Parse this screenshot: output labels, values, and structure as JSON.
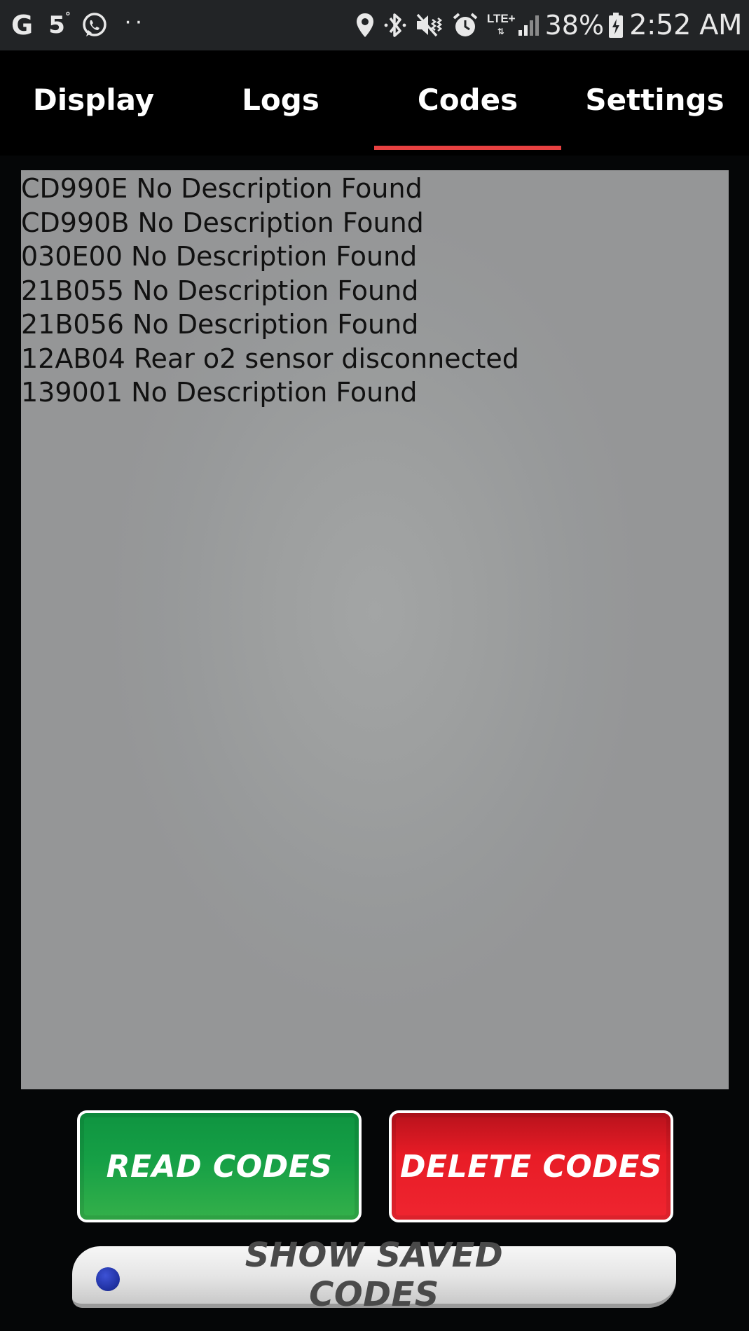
{
  "status_bar": {
    "google_glyph": "G",
    "temperature": "5",
    "temperature_unit": "°",
    "overflow_dots": "··",
    "network_type": "LTE+",
    "battery_percent": "38%",
    "time": "2:52 AM",
    "icons": [
      "google-icon",
      "whatsapp-icon",
      "location-icon",
      "bluetooth-icon",
      "mute-vibrate-icon",
      "alarm-icon",
      "signal-icon",
      "battery-charging-icon"
    ]
  },
  "tabs": [
    {
      "label": "Display",
      "active": false
    },
    {
      "label": "Logs",
      "active": false
    },
    {
      "label": "Codes",
      "active": true
    },
    {
      "label": "Settings",
      "active": false
    }
  ],
  "codes": [
    "CD990E No Description Found",
    "CD990B No Description Found",
    "030E00 No Description Found",
    "21B055 No Description Found",
    "21B056 No Description Found",
    "12AB04 Rear o2 sensor disconnected",
    "139001 No Description Found"
  ],
  "buttons": {
    "read_codes": "READ CODES",
    "delete_codes": "DELETE CODES",
    "show_saved_codes": "SHOW SAVED CODES"
  },
  "colors": {
    "tab_indicator": "#e84141",
    "read_button": "#16a046",
    "delete_button": "#e81c26",
    "panel_background": "#9a9c9c"
  }
}
